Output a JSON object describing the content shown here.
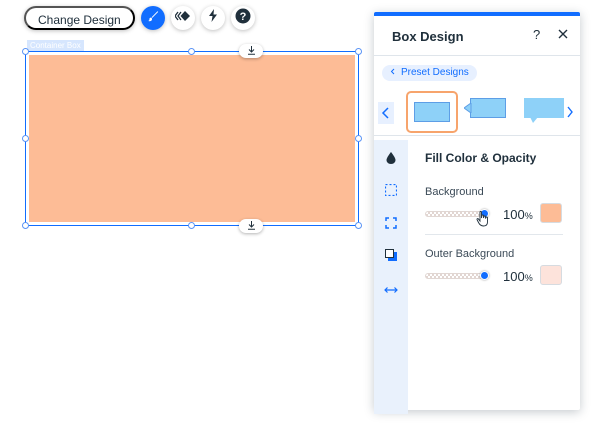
{
  "toolbar": {
    "change_design_label": "Change Design",
    "buttons": [
      {
        "name": "design-brush-icon",
        "active": true
      },
      {
        "name": "animation-icon",
        "active": false
      },
      {
        "name": "lightning-icon",
        "active": false
      },
      {
        "name": "help-icon",
        "active": false
      }
    ]
  },
  "canvas": {
    "container_label": "Container Box",
    "fill_color": "#fdbc96"
  },
  "panel": {
    "title": "Box Design",
    "help_label": "?",
    "preset_label": "Preset Designs",
    "section_title": "Fill Color & Opacity",
    "background": {
      "label": "Background",
      "opacity_value": "100",
      "opacity_unit": "%",
      "opacity_fraction": 1.0,
      "color": "#fdbc96"
    },
    "outer_background": {
      "label": "Outer Background",
      "opacity_value": "100",
      "opacity_unit": "%",
      "opacity_fraction": 1.0,
      "color": "#fde3db"
    },
    "accent_color": "#116dff",
    "sidebar_icons": [
      "fill-drop-icon",
      "border-icon",
      "corners-icon",
      "shadow-icon",
      "layout-arrows-icon"
    ]
  }
}
